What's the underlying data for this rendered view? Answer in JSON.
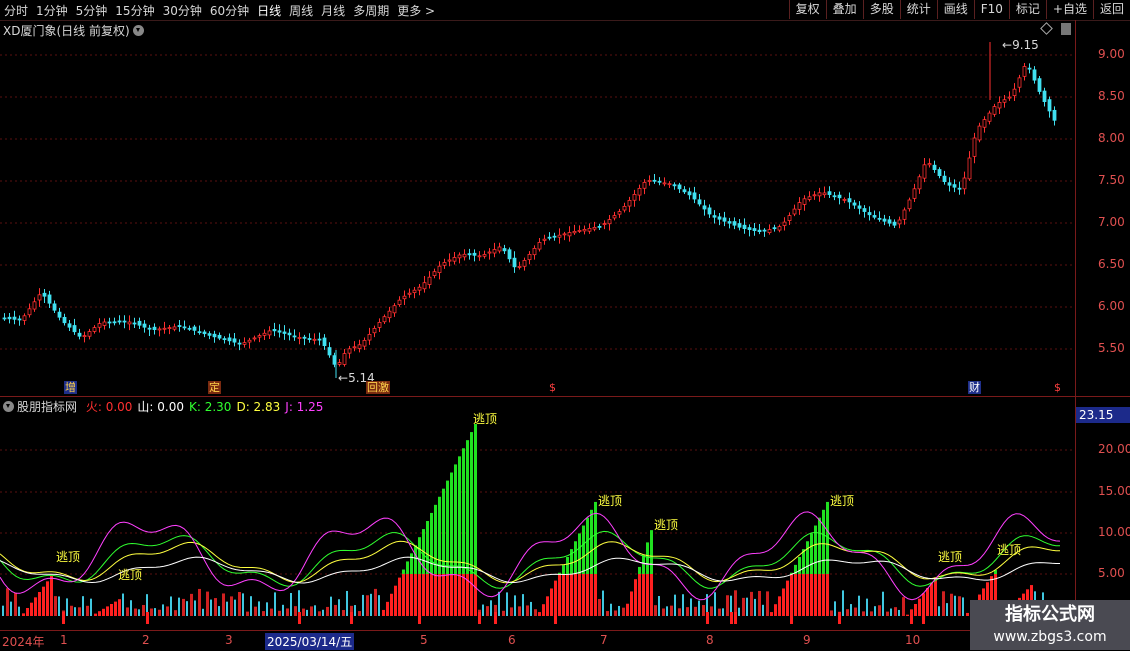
{
  "toolbar": {
    "periods": [
      "分时",
      "1分钟",
      "5分钟",
      "15分钟",
      "30分钟",
      "60分钟",
      "日线",
      "周线",
      "月线",
      "多周期",
      "更多 >"
    ],
    "active_period": "日线",
    "right_buttons": [
      "复权",
      "叠加",
      "多股",
      "统计",
      "画线",
      "F10",
      "标记",
      "+自选",
      "返回"
    ]
  },
  "kline": {
    "title": "XD厦门象(日线 前复权)",
    "high_label": "9.15",
    "low_label": "5.14",
    "y_ticks": [
      "9.00",
      "8.50",
      "8.00",
      "7.50",
      "7.00",
      "6.50",
      "6.00",
      "5.50"
    ],
    "events": [
      {
        "text": "增",
        "color": "#ffd24a",
        "bg": "#1f2f8a"
      },
      {
        "text": "定",
        "color": "#ffd24a",
        "bg": "#7a2a10"
      },
      {
        "text": "回激",
        "color": "#ffd24a",
        "bg": "#7a2a10"
      },
      {
        "text": "$",
        "color": "#ff4040",
        "bg": "transparent"
      },
      {
        "text": "财",
        "color": "#ffffff",
        "bg": "#1f2f8a"
      },
      {
        "text": "$",
        "color": "#ff4040",
        "bg": "transparent"
      }
    ]
  },
  "indicator": {
    "name": "股朋指标网",
    "params": [
      {
        "label": "火: 0.00",
        "color": "#ff3030"
      },
      {
        "label": "山: 0.00",
        "color": "#ffffff"
      },
      {
        "label": "K: 2.30",
        "color": "#30ff30"
      },
      {
        "label": "D: 2.83",
        "color": "#ffff40"
      },
      {
        "label": "J: 1.25",
        "color": "#ff40ff"
      }
    ],
    "current_value": "23.15",
    "y_ticks": [
      "20.00",
      "15.00",
      "10.00",
      "5.00"
    ],
    "annotations": [
      "逃顶",
      "逃顶",
      "逃顶",
      "逃顶",
      "逃顶",
      "逃顶",
      "逃顶",
      "逃顶"
    ]
  },
  "dates": {
    "labels": [
      "2024年",
      "1",
      "2",
      "3",
      "2025/03/14/五",
      "5",
      "6",
      "7",
      "8",
      "9",
      "10"
    ]
  },
  "watermark": {
    "line1": "指标公式网",
    "line2": "www.zbgs3.com"
  },
  "colors": {
    "up": "#ff3030",
    "down": "#40e0f0",
    "grid": "#7a1a1a"
  }
}
